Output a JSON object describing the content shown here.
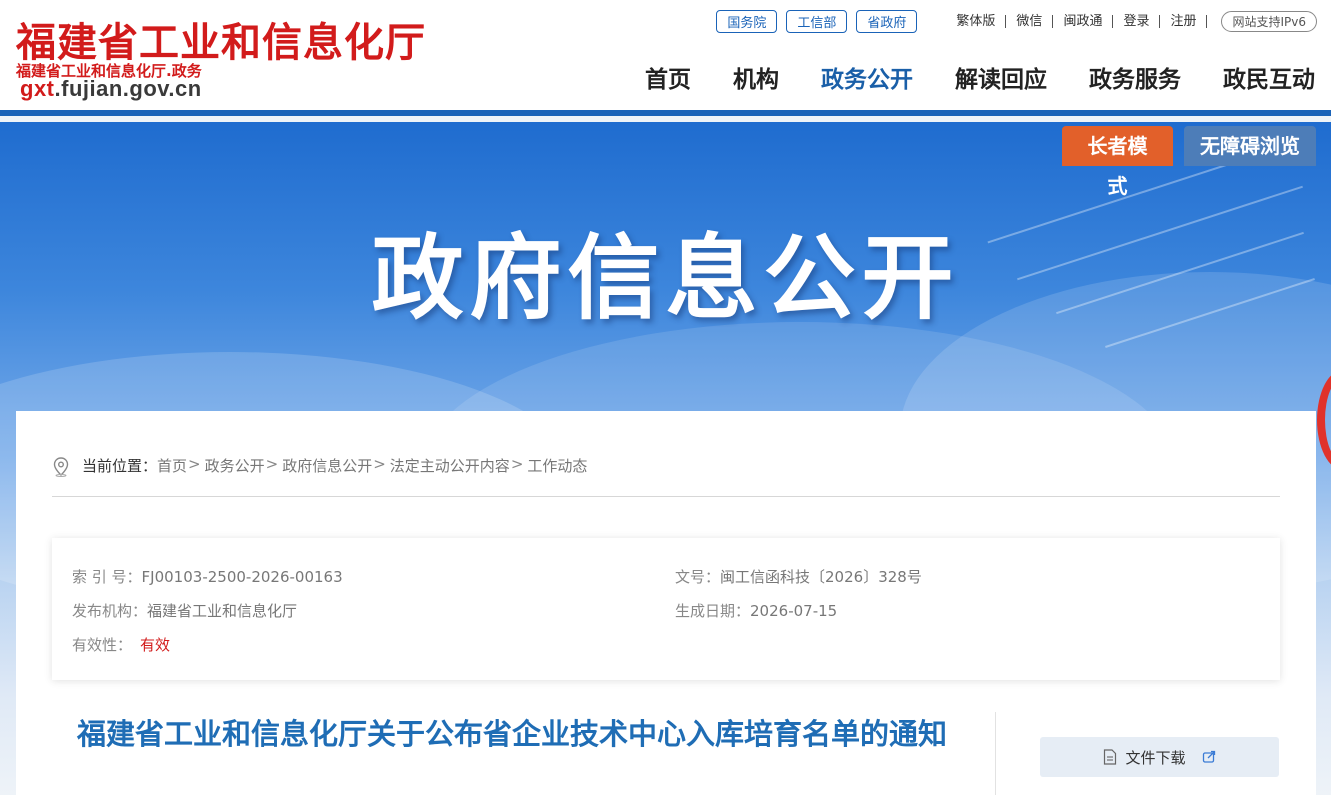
{
  "header": {
    "site_title": "福建省工业和信息化厅",
    "site_sub": "福建省工业和信息化厅.政务",
    "url_prefix": "gxt",
    "url_rest": ".fujian.gov.cn",
    "pills": [
      "国务院",
      "工信部",
      "省政府"
    ],
    "utils": [
      "繁体版",
      "微信",
      "闽政通",
      "登录",
      "注册"
    ],
    "ipv6": "网站支持IPv6",
    "nav": [
      "首页",
      "机构",
      "政务公开",
      "解读回应",
      "政务服务",
      "政民互动"
    ],
    "nav_active": "政务公开"
  },
  "banner": {
    "title": "政府信息公开",
    "elder_mode": "长者模式",
    "accessible": "无障碍浏览"
  },
  "breadcrumb": {
    "label": "当前位置：",
    "items": [
      "首页",
      "政务公开",
      "政府信息公开",
      "法定主动公开内容",
      "工作动态"
    ]
  },
  "info": {
    "index_label": "索 引 号：",
    "index_value": "FJ00103-2500-2026-00163",
    "docno_label": "文号：",
    "docno_value": "闽工信函科技〔2026〕328号",
    "org_label": "发布机构：",
    "org_value": "福建省工业和信息化厅",
    "date_label": "生成日期：",
    "date_value": "2026-07-15",
    "valid_label": "有效性：",
    "valid_value": "有效"
  },
  "document": {
    "title": "福建省工业和信息化厅关于公布省企业技术中心入库培育名单的通知",
    "download_label": "文件下载"
  },
  "colors": {
    "brand_red": "#d21b1b",
    "brand_blue": "#1a63b8",
    "title_blue": "#1f6db5",
    "elder_orange": "#e2602a"
  }
}
